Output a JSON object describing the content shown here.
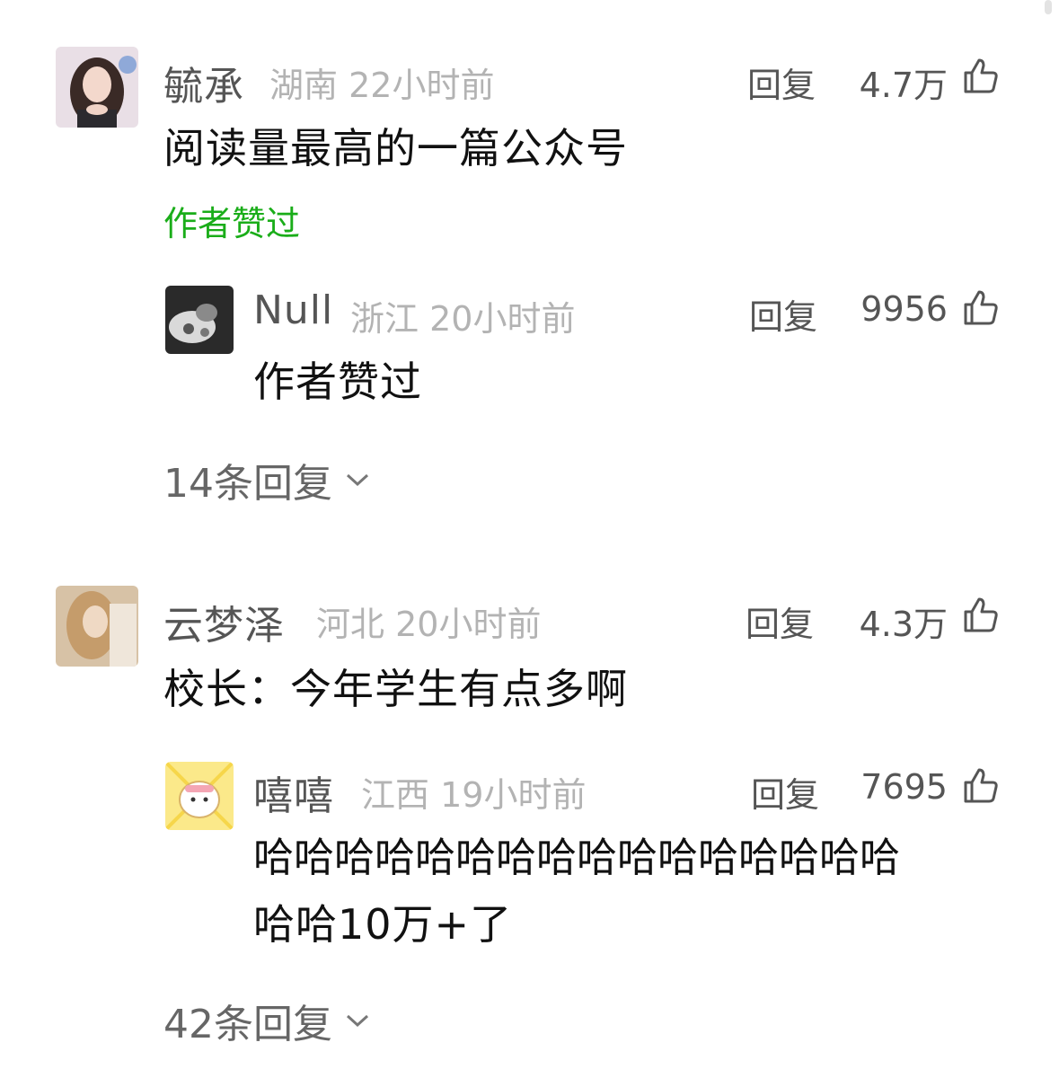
{
  "comments": [
    {
      "name": "毓承",
      "region": "湖南",
      "time": "22小时前",
      "reply_label": "回复",
      "likes": "4.7万",
      "content": "阅读量最高的一篇公众号",
      "tag": "作者赞过",
      "reply": {
        "name": "Null",
        "region": "浙江",
        "time": "20小时前",
        "reply_label": "回复",
        "likes": "9956",
        "content": "作者赞过"
      },
      "more_replies": "14条回复"
    },
    {
      "name": "云梦泽",
      "region": "河北",
      "time": "20小时前",
      "reply_label": "回复",
      "likes": "4.3万",
      "content": "校长：今年学生有点多啊",
      "reply": {
        "name": "嘻嘻",
        "region": "江西",
        "time": "19小时前",
        "reply_label": "回复",
        "likes": "7695",
        "content_line1": "哈哈哈哈哈哈哈哈哈哈哈哈哈哈哈哈",
        "content_line2": "哈哈10万+了"
      },
      "more_replies": "42条回复"
    }
  ],
  "colors": {
    "accent_green": "#1aad19",
    "meta_gray": "#b3b3b3",
    "name_gray": "#555555"
  },
  "icons": {
    "like": "thumbs-up-icon",
    "expand": "chevron-down-icon"
  }
}
